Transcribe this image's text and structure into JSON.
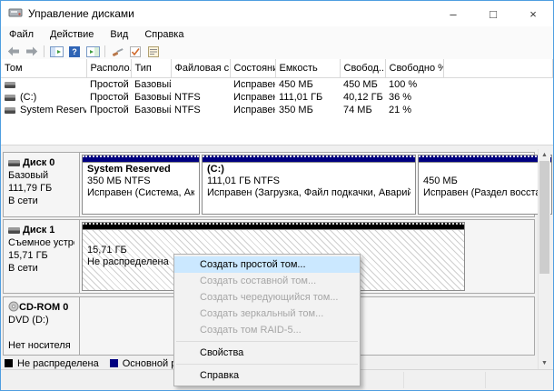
{
  "window": {
    "title": "Управление дисками",
    "controls": {
      "minimize": "–",
      "maximize": "□",
      "close": "×"
    }
  },
  "menubar": {
    "items": [
      "Файл",
      "Действие",
      "Вид",
      "Справка"
    ]
  },
  "toolbar": {
    "icons": [
      "back-arrow",
      "forward-arrow",
      "console-tree",
      "help",
      "action-pane",
      "tool",
      "checkmark",
      "properties"
    ],
    "help_glyph": "?"
  },
  "volume_list": {
    "columns": [
      "Том",
      "Располо...",
      "Тип",
      "Файловая с...",
      "Состояние",
      "Емкость",
      "Свобод...",
      "Свободно %"
    ],
    "rows": [
      {
        "volume": "",
        "layout": "Простой",
        "type": "Базовый",
        "fs": "",
        "status": "Исправен...",
        "capacity": "450 МБ",
        "free": "450 МБ",
        "free_pct": "100 %"
      },
      {
        "volume": "(C:)",
        "layout": "Простой",
        "type": "Базовый",
        "fs": "NTFS",
        "status": "Исправен...",
        "capacity": "111,01 ГБ",
        "free": "40,12 ГБ",
        "free_pct": "36 %"
      },
      {
        "volume": "System Reserved",
        "layout": "Простой",
        "type": "Базовый",
        "fs": "NTFS",
        "status": "Исправен...",
        "capacity": "350 МБ",
        "free": "74 МБ",
        "free_pct": "21 %"
      }
    ]
  },
  "disks": [
    {
      "name": "Диск 0",
      "kind": "Базовый",
      "size": "111,79 ГБ",
      "status": "В сети",
      "partitions": [
        {
          "title": "System Reserved",
          "line2": "350 МБ NTFS",
          "line3": "Исправен (Система, Акти"
        },
        {
          "title": "(C:)",
          "line2": "111,01 ГБ NTFS",
          "line3": "Исправен (Загрузка, Файл подкачки, Аварийный дам"
        },
        {
          "title": "",
          "line2": "450 МБ",
          "line3": "Исправен (Раздел восстан"
        }
      ]
    },
    {
      "name": "Диск 1",
      "kind": "Съемное устро",
      "size": "15,71 ГБ",
      "status": "В сети",
      "unallocated": {
        "line1": "15,71 ГБ",
        "line2": "Не распределена"
      }
    },
    {
      "name": "CD-ROM 0",
      "kind": "DVD (D:)",
      "status": "Нет носителя"
    }
  ],
  "legend": [
    {
      "label": "Не распределена",
      "color": "#000000"
    },
    {
      "label": "Основной раздел",
      "color": "#000080"
    }
  ],
  "context_menu": {
    "items": [
      {
        "label": "Создать простой том..."
      },
      {
        "label": "Создать составной том..."
      },
      {
        "label": "Создать чередующийся том..."
      },
      {
        "label": "Создать зеркальный том..."
      },
      {
        "label": "Создать том RAID-5..."
      },
      {
        "label": "Свойства"
      },
      {
        "label": "Справка"
      }
    ]
  },
  "scrollbar": {
    "up": "▲",
    "down": "▼"
  },
  "colors": {
    "accent_border": "#4f9ee0",
    "primary_partition": "#000080",
    "unallocated": "#000000",
    "menu_highlight": "#cbe8ff"
  }
}
